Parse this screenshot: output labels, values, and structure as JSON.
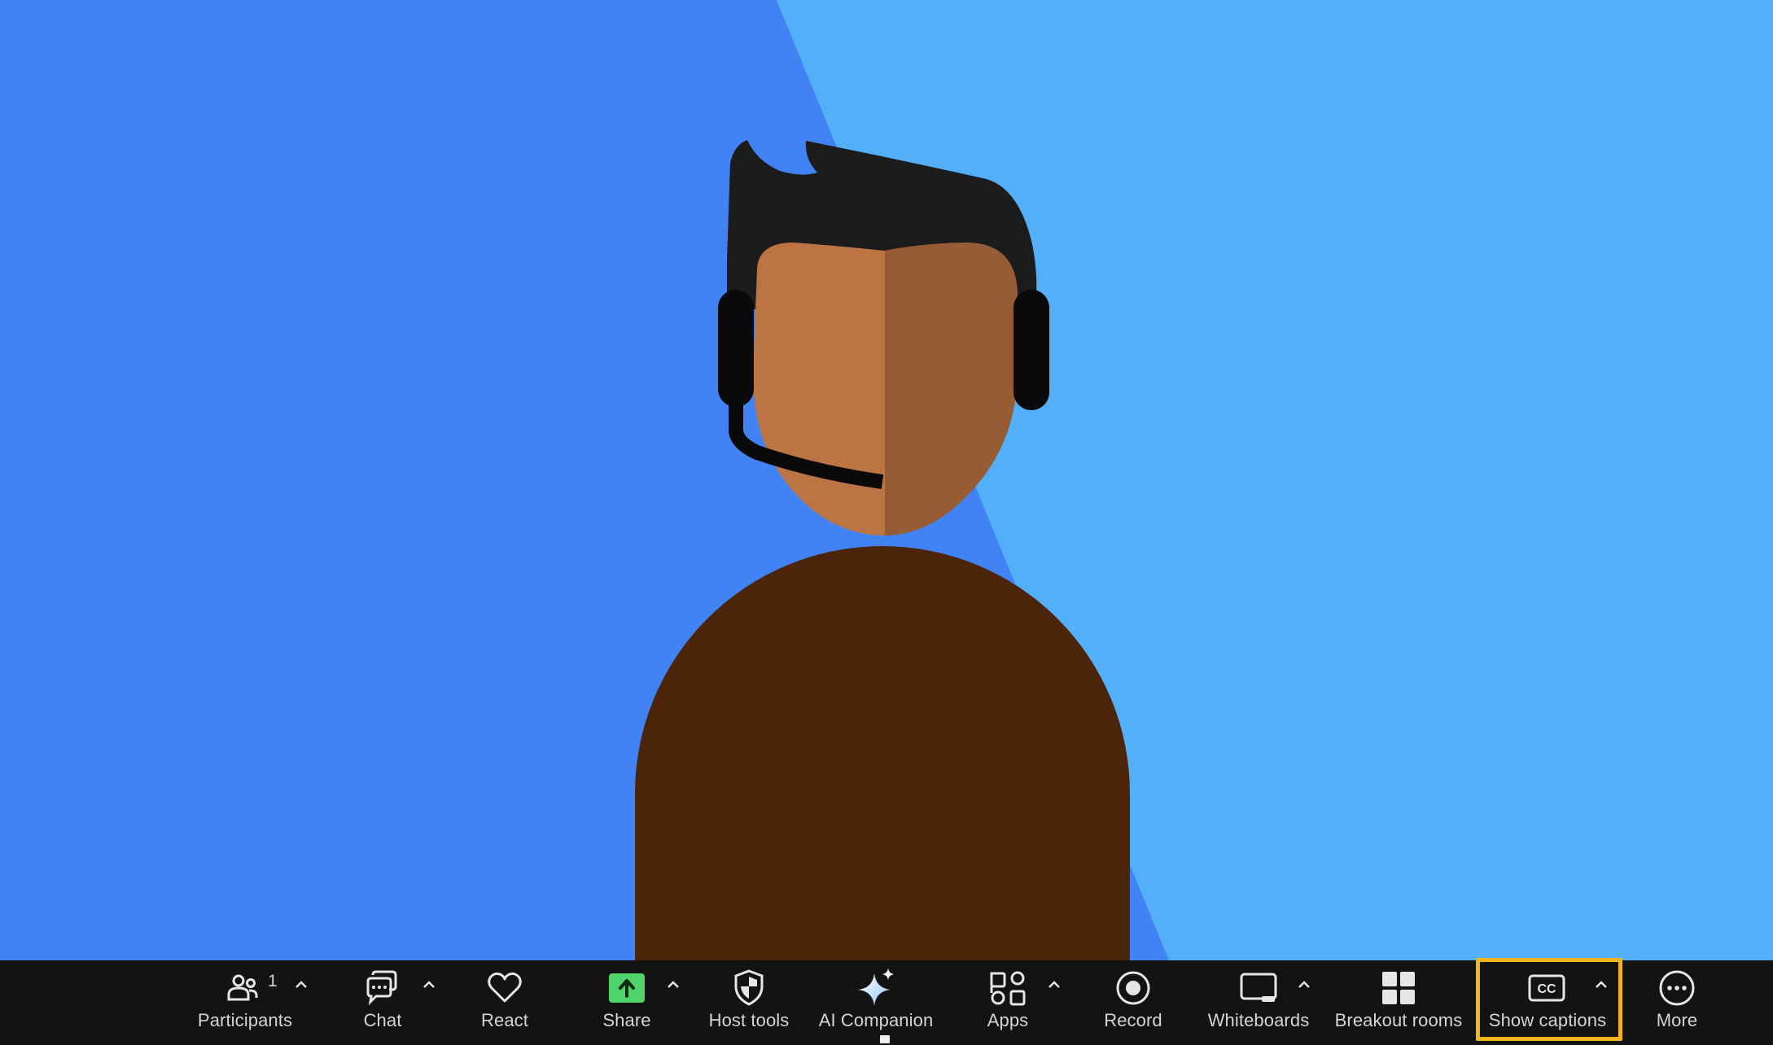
{
  "video": {
    "colors": {
      "background_left": "#4183f4",
      "background_right": "#53aff8",
      "hair": "#1c1c1c",
      "face_left": "#bc7444",
      "face_right": "#965d35",
      "headset": "#0a0a0a",
      "body": "#4c240a"
    }
  },
  "toolbar": {
    "background": "#131313",
    "highlight_color": "#f2b61c",
    "participants": {
      "label": "Participants",
      "count": "1",
      "icon": "participants-icon"
    },
    "chat": {
      "label": "Chat",
      "icon": "chat-icon"
    },
    "react": {
      "label": "React",
      "icon": "heart-icon"
    },
    "share": {
      "label": "Share",
      "icon": "share-arrow-icon",
      "accent": "#4fd36a"
    },
    "host_tools": {
      "label": "Host tools",
      "icon": "shield-icon"
    },
    "ai_companion": {
      "label": "AI Companion",
      "icon": "sparkle-icon"
    },
    "apps": {
      "label": "Apps",
      "icon": "apps-icon"
    },
    "record": {
      "label": "Record",
      "icon": "record-icon"
    },
    "whiteboards": {
      "label": "Whiteboards",
      "icon": "whiteboard-icon"
    },
    "breakout_rooms": {
      "label": "Breakout rooms",
      "icon": "grid-icon"
    },
    "show_captions": {
      "label": "Show captions",
      "icon": "cc-icon",
      "icon_text": "CC"
    },
    "more": {
      "label": "More",
      "icon": "ellipsis-icon"
    }
  }
}
